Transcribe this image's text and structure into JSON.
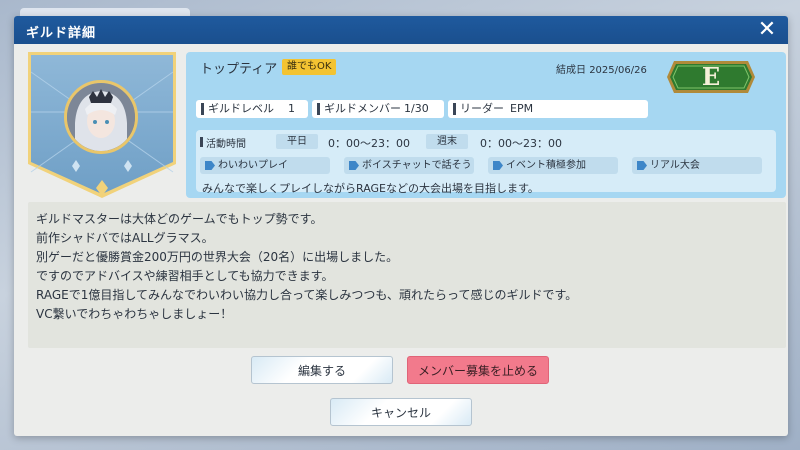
{
  "dialog": {
    "title": "ギルド詳細",
    "close_symbol": "✕"
  },
  "guild": {
    "name": "トップティア",
    "open_badge": "誰でもOK",
    "founded_label": "結成日",
    "founded_date": "2025/06/26",
    "rank": "E",
    "level_label": "ギルドレベル",
    "level_value": "1",
    "members_label": "ギルドメンバー",
    "members_value": "1/30",
    "leader_label": "リーダー",
    "leader_value": "EPM"
  },
  "schedule": {
    "label": "活動時間",
    "weekday_label": "平日",
    "weekday_time": "0：00～23：00",
    "weekend_label": "週末",
    "weekend_time": "0：00～23：00"
  },
  "tags": [
    "わいわいプレイ",
    "ボイスチャットで話そう",
    "イベント積極参加",
    "リアル大会"
  ],
  "motto": "みんなで楽しくプレイしながらRAGEなどの大会出場を目指します。",
  "description": [
    "ギルドマスターは大体どのゲームでもトップ勢です。",
    "前作シャドバではALLグラマス。",
    "別ゲーだと優勝賞金200万円の世界大会（20名）に出場しました。",
    "ですのでアドバイスや練習相手としても協力できます。",
    "RAGEで1億目指してみんなでわいわい協力し合って楽しみつつも、頑れたらって感じのギルドです。",
    "VC繋いでわちゃわちゃしましょー！"
  ],
  "buttons": {
    "edit": "編集する",
    "stop_recruit": "メンバー募集を止める",
    "cancel": "キャンセル"
  },
  "colors": {
    "titlebar": "#1f5a9e",
    "info_panel": "#a6d7f2",
    "badge": "#f3c332",
    "stop_button": "#f27a8c",
    "rank_plate": "#2f7a2f"
  }
}
